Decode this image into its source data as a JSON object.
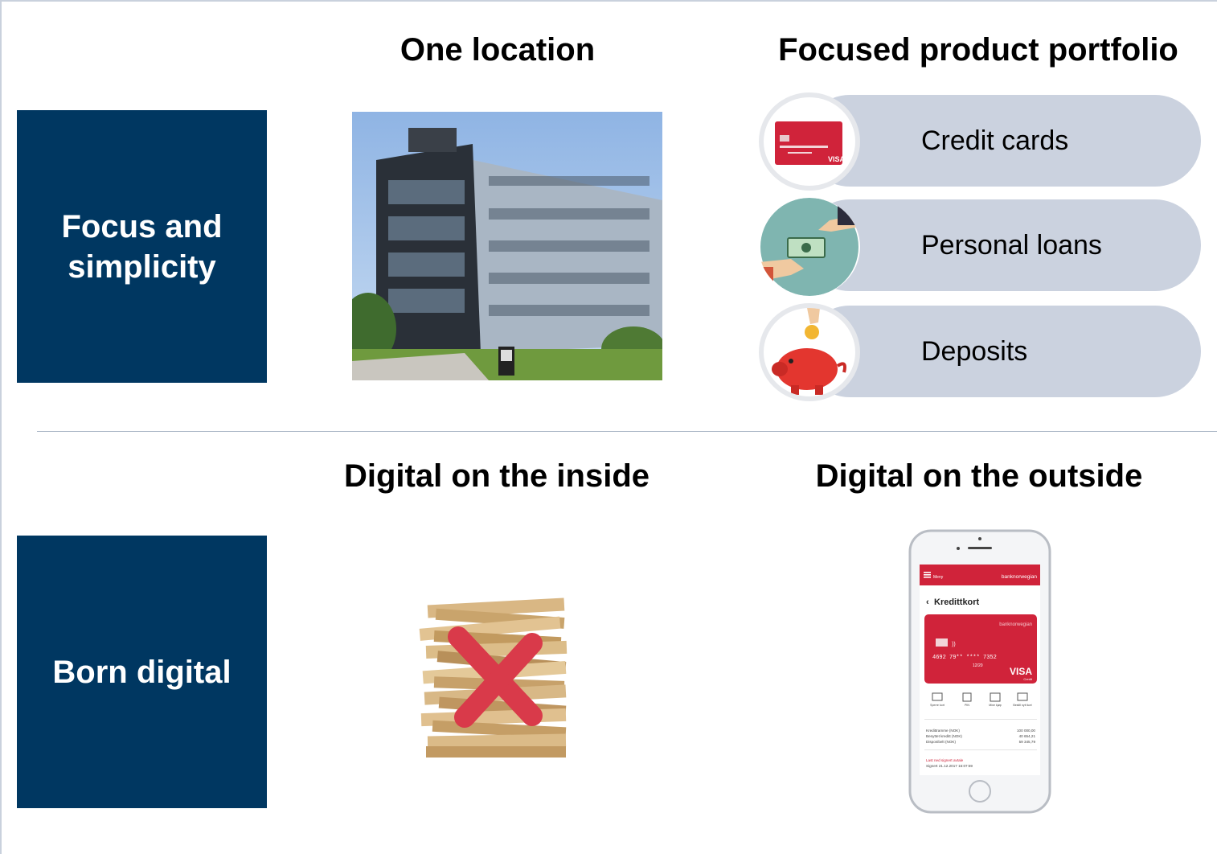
{
  "headings": {
    "one_location": "One location",
    "focused_portfolio": "Focused product portfolio",
    "digital_inside": "Digital on the inside",
    "digital_outside": "Digital on the outside"
  },
  "boxes": {
    "focus_line1": "Focus and",
    "focus_line2": "simplicity",
    "born_digital": "Born digital"
  },
  "products": [
    {
      "label": "Credit cards",
      "icon": "credit-card-icon"
    },
    {
      "label": "Personal loans",
      "icon": "money-exchange-icon"
    },
    {
      "label": "Deposits",
      "icon": "piggy-bank-icon"
    }
  ],
  "credit_card": {
    "brand": "VISA"
  },
  "phone": {
    "menu_label": "Meny",
    "brand": "banknorwegian",
    "screen_title": "Kredittkort",
    "card_brand": "banknorwegian",
    "card_number": "4692 79** **** 7352",
    "card_expiry": "12/20",
    "card_visa": "VISA",
    "card_visa_sub": "Credit",
    "actions": [
      "Sperre kort",
      "PIN",
      "Mine kjøp",
      "Bestill nytt kort"
    ],
    "rows": [
      {
        "label": "Kredittramme (NOK)",
        "value": "100 000,00"
      },
      {
        "label": "Benyttet kreditt (NOK)",
        "value": "40 654,21"
      },
      {
        "label": "Disponibelt (NOK)",
        "value": "59 345,79"
      }
    ],
    "agreement_link": "Last ned signert avtale",
    "agreement_signed": "Signert 21.12.2017 16:07:59"
  },
  "colors": {
    "navy": "#003761",
    "pill": "#cbd2df",
    "bank_red": "#d0233a",
    "x_red": "#d93a4a"
  }
}
